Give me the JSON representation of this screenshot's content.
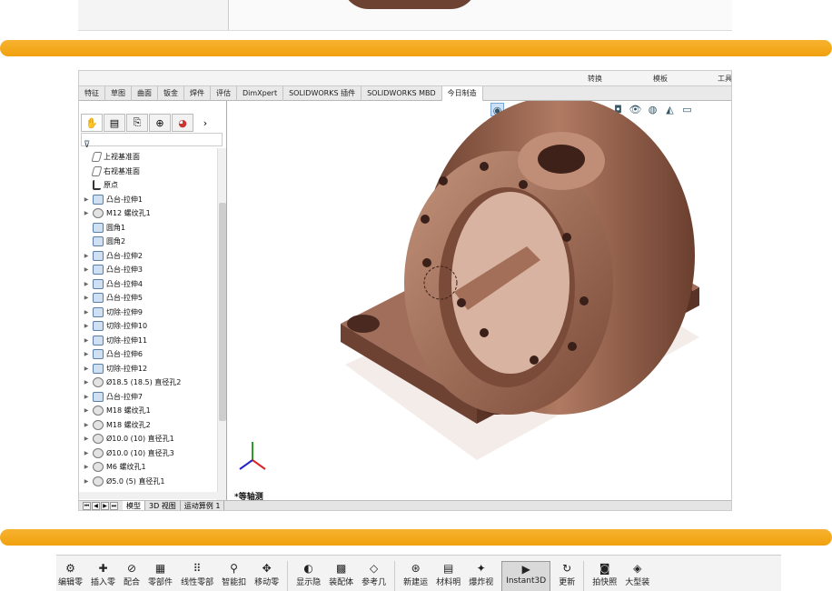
{
  "colors": {
    "divider_bar": "#f0a10e",
    "part_main": "#8b5a45",
    "part_light": "#c4937b",
    "part_dark": "#5e3628"
  },
  "cmd_top": {
    "labels": [
      "转换",
      "模板",
      "工具"
    ]
  },
  "tabs": [
    "特征",
    "草图",
    "曲面",
    "钣金",
    "焊件",
    "评估",
    "DimXpert",
    "SOLIDWORKS 插件",
    "SOLIDWORKS MBD",
    "今日制造"
  ],
  "active_tab": "今日制造",
  "feature_manager": {
    "panel_icons": [
      "part-icon",
      "property-icon",
      "config-icon",
      "target-icon",
      "appearance-icon"
    ],
    "items": [
      {
        "label": "上视基准面",
        "icon": "plane",
        "expandable": false
      },
      {
        "label": "右视基准面",
        "icon": "plane",
        "expandable": false
      },
      {
        "label": "原点",
        "icon": "origin",
        "expandable": false
      },
      {
        "label": "凸台-拉伸1",
        "icon": "feature",
        "expandable": true
      },
      {
        "label": "M12 螺纹孔1",
        "icon": "hole",
        "expandable": true
      },
      {
        "label": "圆角1",
        "icon": "feature",
        "expandable": false
      },
      {
        "label": "圆角2",
        "icon": "feature",
        "expandable": false
      },
      {
        "label": "凸台-拉伸2",
        "icon": "feature",
        "expandable": true
      },
      {
        "label": "凸台-拉伸3",
        "icon": "feature",
        "expandable": true
      },
      {
        "label": "凸台-拉伸4",
        "icon": "feature",
        "expandable": true
      },
      {
        "label": "凸台-拉伸5",
        "icon": "feature",
        "expandable": true
      },
      {
        "label": "切除-拉伸9",
        "icon": "feature",
        "expandable": true
      },
      {
        "label": "切除-拉伸10",
        "icon": "feature",
        "expandable": true
      },
      {
        "label": "切除-拉伸11",
        "icon": "feature",
        "expandable": true
      },
      {
        "label": "凸台-拉伸6",
        "icon": "feature",
        "expandable": true
      },
      {
        "label": "切除-拉伸12",
        "icon": "feature",
        "expandable": true
      },
      {
        "label": "Ø18.5 (18.5) 直径孔2",
        "icon": "hole",
        "expandable": true
      },
      {
        "label": "凸台-拉伸7",
        "icon": "feature",
        "expandable": true
      },
      {
        "label": "M18 螺纹孔1",
        "icon": "hole",
        "expandable": true
      },
      {
        "label": "M18 螺纹孔2",
        "icon": "hole",
        "expandable": true
      },
      {
        "label": "Ø10.0 (10) 直径孔1",
        "icon": "hole",
        "expandable": true
      },
      {
        "label": "Ø10.0 (10) 直径孔3",
        "icon": "hole",
        "expandable": true
      },
      {
        "label": "M6 螺纹孔1",
        "icon": "hole",
        "expandable": true
      },
      {
        "label": "Ø5.0 (5) 直径孔1",
        "icon": "hole",
        "expandable": true
      }
    ]
  },
  "bottom_tabs": [
    "模型",
    "3D 视图",
    "运动算例 1"
  ],
  "active_bottom_tab": "模型",
  "view_label": "*等轴测",
  "assembly_toolbar": {
    "items": [
      {
        "label": "编辑零",
        "icon": "edit-component-icon"
      },
      {
        "label": "插入零",
        "icon": "insert-component-icon"
      },
      {
        "label": "配合",
        "icon": "mate-icon"
      },
      {
        "label": "零部件",
        "icon": "component-preview-icon"
      },
      {
        "label": "线性零部",
        "icon": "linear-pattern-icon"
      },
      {
        "label": "智能扣",
        "icon": "smart-fastener-icon"
      },
      {
        "label": "移动零",
        "icon": "move-component-icon"
      },
      {
        "label": "显示隐",
        "icon": "show-hidden-icon"
      },
      {
        "label": "装配体",
        "icon": "assembly-features-icon"
      },
      {
        "label": "参考几",
        "icon": "reference-geometry-icon"
      },
      {
        "label": "新建运",
        "icon": "new-motion-icon"
      },
      {
        "label": "材料明",
        "icon": "bom-icon"
      },
      {
        "label": "爆炸视",
        "icon": "exploded-view-icon"
      },
      {
        "label": "Instant3D",
        "icon": "instant3d-icon"
      },
      {
        "label": "更新",
        "icon": "update-icon"
      },
      {
        "label": "拍快照",
        "icon": "snapshot-icon"
      },
      {
        "label": "大型装",
        "icon": "large-assembly-icon"
      }
    ],
    "active_label": "Instant3D"
  }
}
